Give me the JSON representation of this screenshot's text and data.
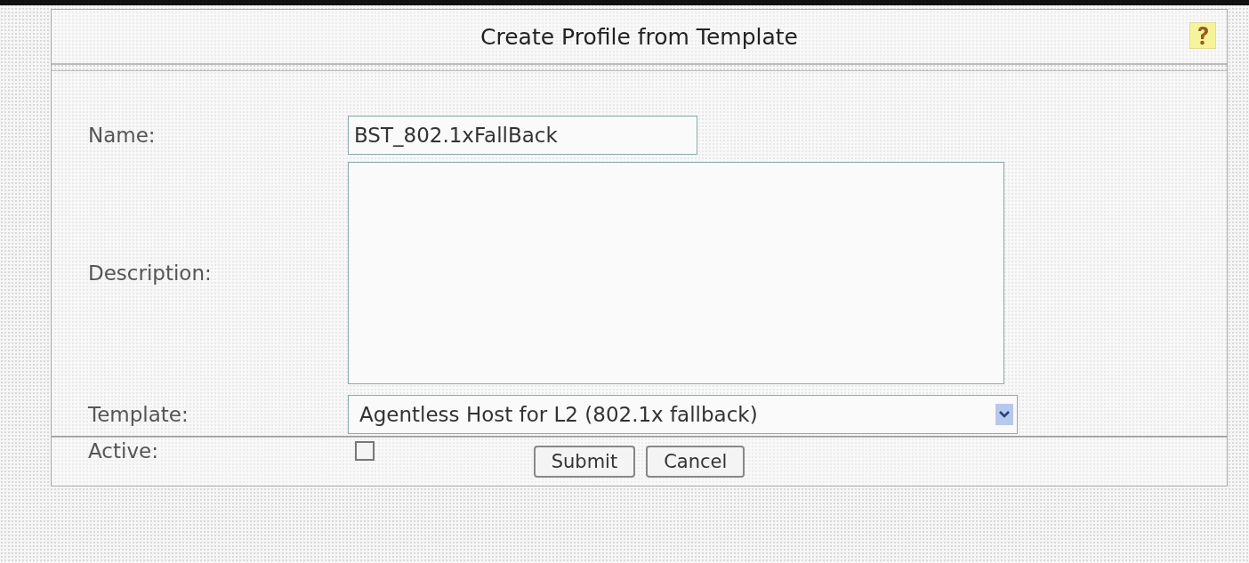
{
  "title": "Create Profile from Template",
  "fields": [
    {
      "kind": "text",
      "label": "Name:",
      "value": "BST_802.1xFallBack"
    },
    {
      "kind": "textarea",
      "label": "Description:"
    },
    {
      "kind": "select",
      "label": "Template:",
      "value": "Agentless Host for L2 (802.1x fallback)"
    },
    {
      "kind": "checkbox",
      "label": "Active:",
      "checked": false
    }
  ],
  "buttons": [
    "Submit",
    "Cancel"
  ]
}
